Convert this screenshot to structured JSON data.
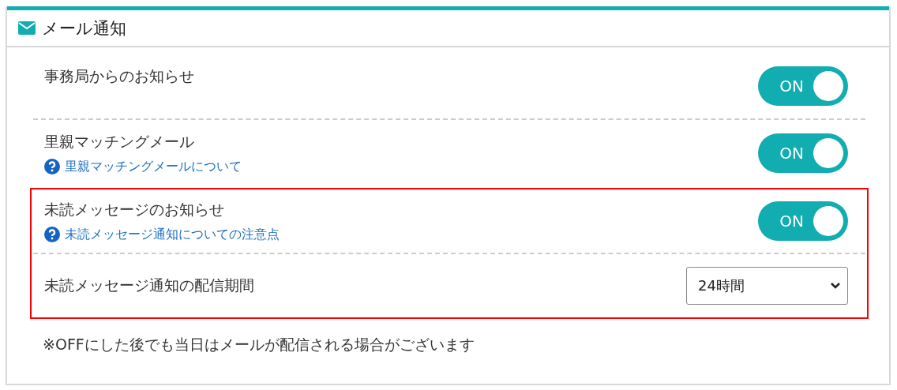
{
  "panel": {
    "title": "メール通知"
  },
  "groups": [
    {
      "highlighted": false,
      "rows": [
        {
          "kind": "toggle",
          "label": "事務局からのお知らせ",
          "toggle": {
            "label": "ON",
            "on": true
          }
        },
        {
          "kind": "toggle",
          "label": "里親マッチングメール",
          "help_link": "里親マッチングメールについて",
          "toggle": {
            "label": "ON",
            "on": true
          }
        }
      ]
    },
    {
      "highlighted": true,
      "rows": [
        {
          "kind": "toggle",
          "label": "未読メッセージのお知らせ",
          "help_link": "未読メッセージ通知についての注意点",
          "toggle": {
            "label": "ON",
            "on": true
          }
        },
        {
          "kind": "select",
          "label": "未読メッセージ通知の配信期間",
          "select": {
            "value": "24時間"
          }
        }
      ]
    }
  ],
  "note": "※OFFにした後でも当日はメールが配信される場合がございます"
}
